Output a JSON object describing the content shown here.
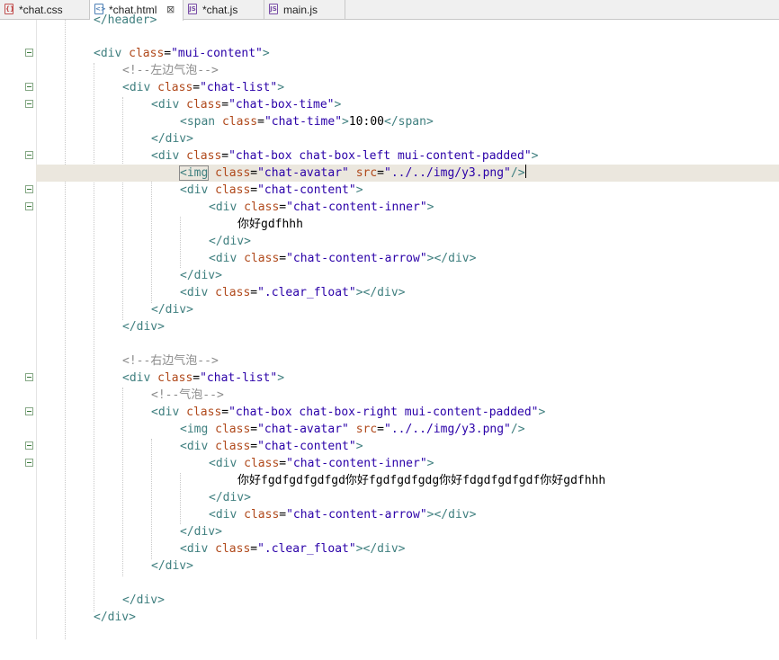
{
  "tabs": [
    {
      "label": "*chat.css",
      "icon": "css-file-icon",
      "active": false
    },
    {
      "label": "*chat.html",
      "icon": "html-file-icon",
      "active": true,
      "close": "⊠"
    },
    {
      "label": "*chat.js",
      "icon": "js-file-icon",
      "active": false
    },
    {
      "label": "main.js",
      "icon": "js-file-icon",
      "active": false
    }
  ],
  "colors": {
    "tag": "#3f7f7f",
    "attr": "#b0491b",
    "value": "#2a00a8",
    "comment": "#8c8c8c",
    "current_line": "#ebe7de"
  },
  "code": {
    "l0": {
      "text": "</header>"
    },
    "l2": {
      "open": "<div",
      "a1": "class",
      "eq1": "=",
      "v1": "\"mui-content\"",
      "close": ">"
    },
    "l3": {
      "text": "<!--左边气泡-->"
    },
    "l4": {
      "open": "<div",
      "a1": "class",
      "eq1": "=",
      "v1": "\"chat-list\"",
      "close": ">"
    },
    "l5": {
      "open": "<div",
      "a1": "class",
      "eq1": "=",
      "v1": "\"chat-box-time\"",
      "close": ">"
    },
    "l6": {
      "open": "<span",
      "a1": "class",
      "eq1": "=",
      "v1": "\"chat-time\"",
      "close": ">",
      "text": "10:00",
      "end": "</span>"
    },
    "l7": {
      "text": "</div>"
    },
    "l8": {
      "open": "<div",
      "a1": "class",
      "eq1": "=",
      "v1": "\"chat-box chat-box-left mui-content-padded\"",
      "close": ">"
    },
    "l9": {
      "open": "<img",
      "a1": "class",
      "eq1": "=",
      "v1": "\"chat-avatar\"",
      "a2": "src",
      "eq2": "=",
      "v2": "\"../../img/y3.png\"",
      "close": "/>"
    },
    "l10": {
      "open": "<div",
      "a1": "class",
      "eq1": "=",
      "v1": "\"chat-content\"",
      "close": ">"
    },
    "l11": {
      "open": "<div",
      "a1": "class",
      "eq1": "=",
      "v1": "\"chat-content-inner\"",
      "close": ">"
    },
    "l12": {
      "text": "你好gdfhhh"
    },
    "l13": {
      "text": "</div>"
    },
    "l14": {
      "open": "<div",
      "a1": "class",
      "eq1": "=",
      "v1": "\"chat-content-arrow\"",
      "close": "></div>"
    },
    "l15": {
      "text": "</div>"
    },
    "l16": {
      "open": "<div",
      "a1": "class",
      "eq1": "=",
      "v1": "\".clear_float\"",
      "close": "></div>"
    },
    "l17": {
      "text": "</div>"
    },
    "l18": {
      "text": "</div>"
    },
    "l20": {
      "text": "<!--右边气泡-->"
    },
    "l21": {
      "open": "<div",
      "a1": "class",
      "eq1": "=",
      "v1": "\"chat-list\"",
      "close": ">"
    },
    "l22": {
      "text": "<!--气泡-->"
    },
    "l23": {
      "open": "<div",
      "a1": "class",
      "eq1": "=",
      "v1": "\"chat-box chat-box-right mui-content-padded\"",
      "close": ">"
    },
    "l24": {
      "open": "<img",
      "a1": "class",
      "eq1": "=",
      "v1": "\"chat-avatar\"",
      "a2": "src",
      "eq2": "=",
      "v2": "\"../../img/y3.png\"",
      "close": "/>"
    },
    "l25": {
      "open": "<div",
      "a1": "class",
      "eq1": "=",
      "v1": "\"chat-content\"",
      "close": ">"
    },
    "l26": {
      "open": "<div",
      "a1": "class",
      "eq1": "=",
      "v1": "\"chat-content-inner\"",
      "close": ">"
    },
    "l27": {
      "text": "你好fgdfgdfgdfgd你好fgdfgdfgdg你好fdgdfgdfgdf你好gdfhhh"
    },
    "l28": {
      "text": "</div>"
    },
    "l29": {
      "open": "<div",
      "a1": "class",
      "eq1": "=",
      "v1": "\"chat-content-arrow\"",
      "close": "></div>"
    },
    "l30": {
      "text": "</div>"
    },
    "l31": {
      "open": "<div",
      "a1": "class",
      "eq1": "=",
      "v1": "\".clear_float\"",
      "close": "></div>"
    },
    "l32": {
      "text": "</div>"
    },
    "l34": {
      "text": "</div>"
    },
    "l35": {
      "text": "</div>"
    }
  }
}
